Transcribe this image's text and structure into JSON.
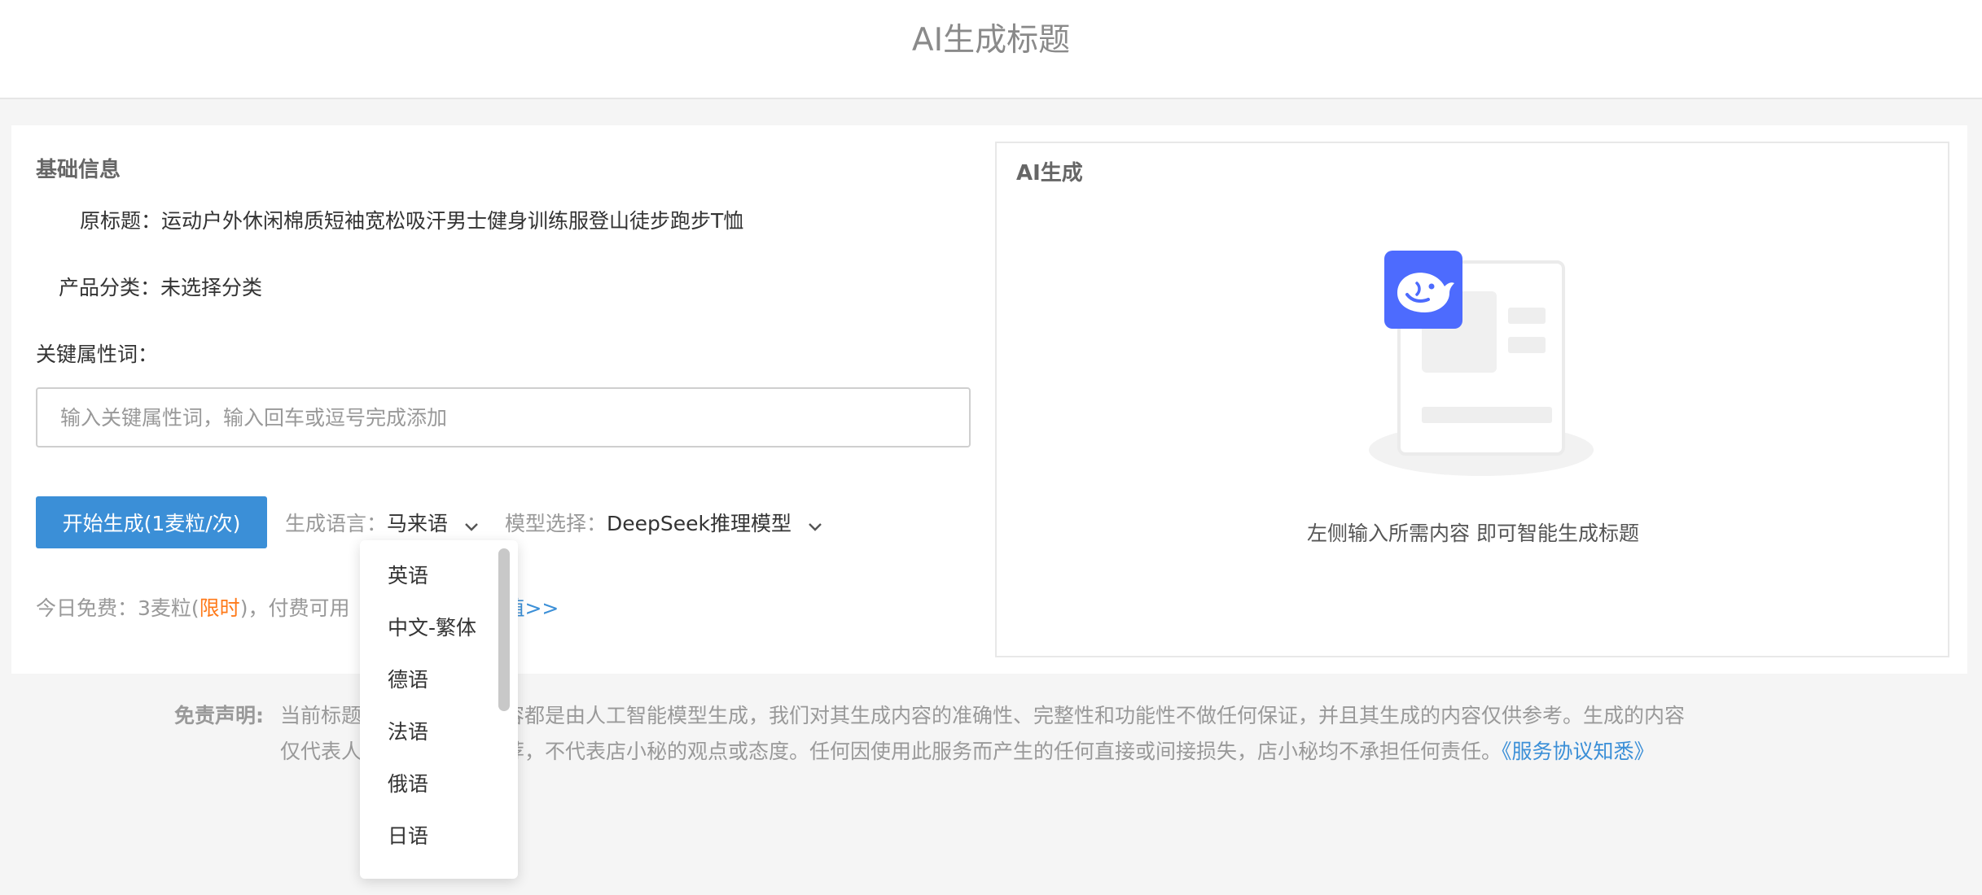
{
  "header": {
    "title": "AI生成标题"
  },
  "basic": {
    "section_title": "基础信息",
    "original_title_label": "原标题：",
    "original_title_value": "运动户外休闲棉质短袖宽松吸汗男士健身训练服登山徒步跑步T恤",
    "category_label": "产品分类：",
    "category_value": "未选择分类",
    "keyword_label": "关键属性词：",
    "keyword_placeholder": "输入关键属性词，输入回车或逗号完成添加",
    "keyword_value": ""
  },
  "actions": {
    "generate_button": "开始生成(1麦粒/次)",
    "language_label": "生成语言：",
    "language_value": "马来语",
    "model_label": "模型选择：",
    "model_value": "DeepSeek推理模型"
  },
  "free_info": {
    "prefix": "今日免费：3麦粒(",
    "limited": "限时",
    "suffix": ")，付费可用",
    "recharge_link": "值>>"
  },
  "ai_panel": {
    "title": "AI生成",
    "empty_text": "左侧输入所需内容 即可智能生成标题",
    "logo_icon": "deepseek-whale-icon",
    "brand_color": "#4d6bfe"
  },
  "language_dropdown": {
    "options": [
      "英语",
      "中文-繁体",
      "德语",
      "法语",
      "俄语",
      "日语"
    ]
  },
  "disclaimer": {
    "label": "免责声明:",
    "line1": "当前标题　　　　所有内容都是由人工智能模型生成，我们对其生成内容的准确性、完整性和功能性不做任何保证，并且其生成的内容仅供参考。生成的内容",
    "line2": "仅代表人　　　　测和推荐，不代表店小秘的观点或态度。任何因使用此服务而产生的任何直接或间接损失，店小秘均不承担任何责任。",
    "link": "《服务协议知悉》"
  },
  "colors": {
    "primary": "#3b8fd7",
    "accent": "#ff7a1a"
  }
}
